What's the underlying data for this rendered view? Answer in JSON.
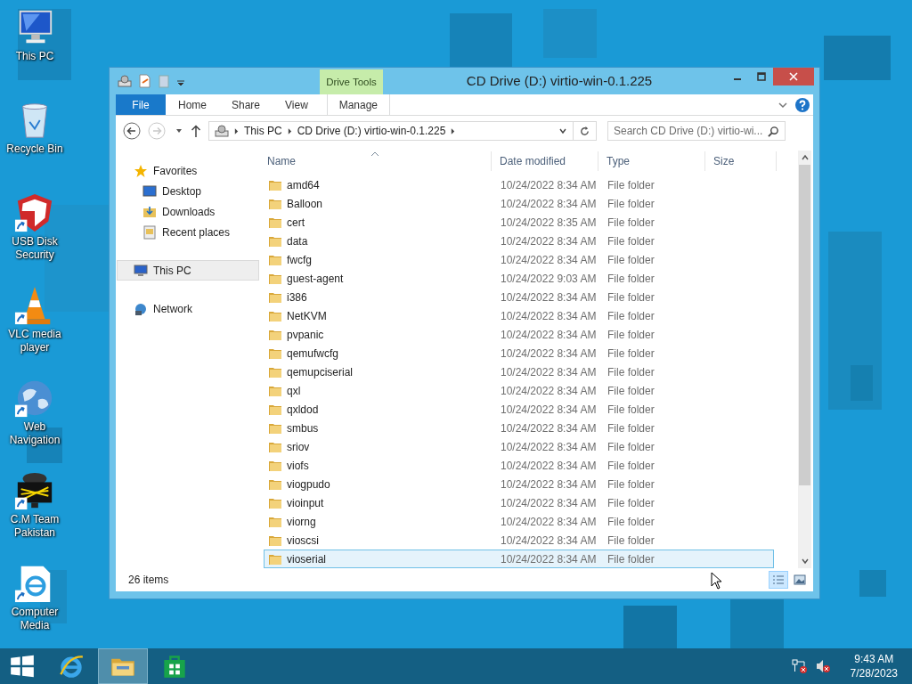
{
  "desktop_icons": [
    {
      "label": "This PC",
      "kind": "pc",
      "shortcut": false
    },
    {
      "label": "Recycle Bin",
      "kind": "bin",
      "shortcut": false
    },
    {
      "label": "USB Disk Security",
      "kind": "shield",
      "shortcut": true
    },
    {
      "label": "VLC media player",
      "kind": "cone",
      "shortcut": true
    },
    {
      "label": "Web Navigation",
      "kind": "globe",
      "shortcut": true
    },
    {
      "label": "C.M Team Pakistan",
      "kind": "cm",
      "shortcut": true
    },
    {
      "label": "Computer Media",
      "kind": "ie",
      "shortcut": true
    }
  ],
  "window": {
    "title": "CD Drive (D:) virtio-win-0.1.225",
    "context_tab": "Drive Tools",
    "ribbon_tabs": [
      {
        "label": "File",
        "kind": "file"
      },
      {
        "label": "Home",
        "kind": "tab"
      },
      {
        "label": "Share",
        "kind": "tab"
      },
      {
        "label": "View",
        "kind": "tab"
      },
      {
        "label": "Manage",
        "kind": "context"
      }
    ],
    "forward_disabled": true,
    "breadcrumb": [
      "This PC",
      "CD Drive (D:) virtio-win-0.1.225"
    ],
    "search": {
      "placeholder": "Search CD Drive (D:) virtio-wi..."
    },
    "nav": [
      {
        "label": "Favorites",
        "kind": "star",
        "selected": false,
        "children": [
          {
            "label": "Desktop",
            "kind": "desktop",
            "selected": false
          },
          {
            "label": "Downloads",
            "kind": "downloads",
            "selected": false
          },
          {
            "label": "Recent places",
            "kind": "recent",
            "selected": false
          }
        ]
      },
      {
        "label": "This PC",
        "kind": "pc",
        "selected": true
      },
      {
        "label": "Network",
        "kind": "network",
        "selected": false
      }
    ],
    "columns": [
      {
        "label": "Name",
        "sorted": true
      },
      {
        "label": "Date modified",
        "sorted": false
      },
      {
        "label": "Type",
        "sorted": false
      },
      {
        "label": "Size",
        "sorted": false
      }
    ],
    "rows": [
      {
        "name": "amd64",
        "date": "10/24/2022 8:34 AM",
        "type": "File folder",
        "selected": false
      },
      {
        "name": "Balloon",
        "date": "10/24/2022 8:34 AM",
        "type": "File folder",
        "selected": false
      },
      {
        "name": "cert",
        "date": "10/24/2022 8:35 AM",
        "type": "File folder",
        "selected": false
      },
      {
        "name": "data",
        "date": "10/24/2022 8:34 AM",
        "type": "File folder",
        "selected": false
      },
      {
        "name": "fwcfg",
        "date": "10/24/2022 8:34 AM",
        "type": "File folder",
        "selected": false
      },
      {
        "name": "guest-agent",
        "date": "10/24/2022 9:03 AM",
        "type": "File folder",
        "selected": false
      },
      {
        "name": "i386",
        "date": "10/24/2022 8:34 AM",
        "type": "File folder",
        "selected": false
      },
      {
        "name": "NetKVM",
        "date": "10/24/2022 8:34 AM",
        "type": "File folder",
        "selected": false
      },
      {
        "name": "pvpanic",
        "date": "10/24/2022 8:34 AM",
        "type": "File folder",
        "selected": false
      },
      {
        "name": "qemufwcfg",
        "date": "10/24/2022 8:34 AM",
        "type": "File folder",
        "selected": false
      },
      {
        "name": "qemupciserial",
        "date": "10/24/2022 8:34 AM",
        "type": "File folder",
        "selected": false
      },
      {
        "name": "qxl",
        "date": "10/24/2022 8:34 AM",
        "type": "File folder",
        "selected": false
      },
      {
        "name": "qxldod",
        "date": "10/24/2022 8:34 AM",
        "type": "File folder",
        "selected": false
      },
      {
        "name": "smbus",
        "date": "10/24/2022 8:34 AM",
        "type": "File folder",
        "selected": false
      },
      {
        "name": "sriov",
        "date": "10/24/2022 8:34 AM",
        "type": "File folder",
        "selected": false
      },
      {
        "name": "viofs",
        "date": "10/24/2022 8:34 AM",
        "type": "File folder",
        "selected": false
      },
      {
        "name": "viogpudo",
        "date": "10/24/2022 8:34 AM",
        "type": "File folder",
        "selected": false
      },
      {
        "name": "vioinput",
        "date": "10/24/2022 8:34 AM",
        "type": "File folder",
        "selected": false
      },
      {
        "name": "viorng",
        "date": "10/24/2022 8:34 AM",
        "type": "File folder",
        "selected": false
      },
      {
        "name": "vioscsi",
        "date": "10/24/2022 8:34 AM",
        "type": "File folder",
        "selected": false
      },
      {
        "name": "vioserial",
        "date": "10/24/2022 8:34 AM",
        "type": "File folder",
        "selected": true
      }
    ],
    "status": "26 items",
    "views": [
      {
        "kind": "details",
        "selected": true
      },
      {
        "kind": "large",
        "selected": false
      }
    ]
  },
  "taskbar": {
    "apps": [
      {
        "kind": "ie",
        "selected": false
      },
      {
        "kind": "explorer",
        "selected": true
      },
      {
        "kind": "store",
        "selected": false
      }
    ],
    "time": "9:43 AM",
    "date": "7/28/2023"
  }
}
